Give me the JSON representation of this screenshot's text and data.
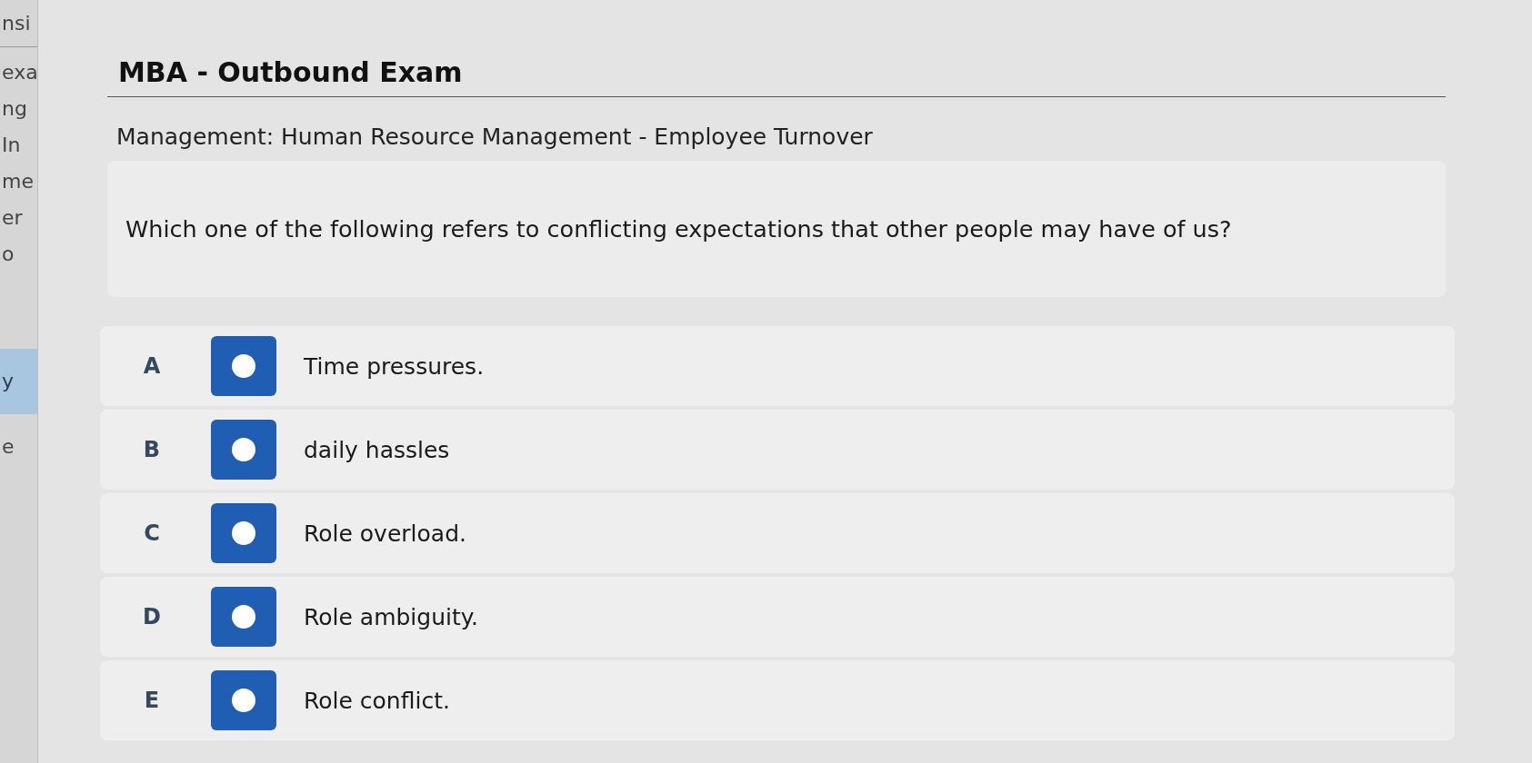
{
  "sidebar": {
    "header": "nsi",
    "sections": [
      {
        "items": [
          {
            "label": "exa",
            "selected": false
          },
          {
            "label": "ng",
            "selected": false
          },
          {
            "label": "In",
            "selected": false
          },
          {
            "label": "me",
            "selected": false
          },
          {
            "label": "er",
            "selected": false
          },
          {
            "label": "o",
            "selected": false
          }
        ]
      },
      {
        "items": [
          {
            "label": "y",
            "selected": true
          },
          {
            "label": "e",
            "selected": false
          }
        ]
      }
    ]
  },
  "exam": {
    "title": "MBA - Outbound Exam",
    "subject": "Management: Human Resource Management - Employee Turnover"
  },
  "question": {
    "text": "Which one of the following refers to conflicting expectations that other people may have of us?"
  },
  "options": [
    {
      "letter": "A",
      "text": "Time pressures.",
      "selected": false
    },
    {
      "letter": "B",
      "text": "daily hassles",
      "selected": false
    },
    {
      "letter": "C",
      "text": "Role overload.",
      "selected": false
    },
    {
      "letter": "D",
      "text": "Role ambiguity.",
      "selected": false
    },
    {
      "letter": "E",
      "text": "Role conflict.",
      "selected": false
    }
  ]
}
